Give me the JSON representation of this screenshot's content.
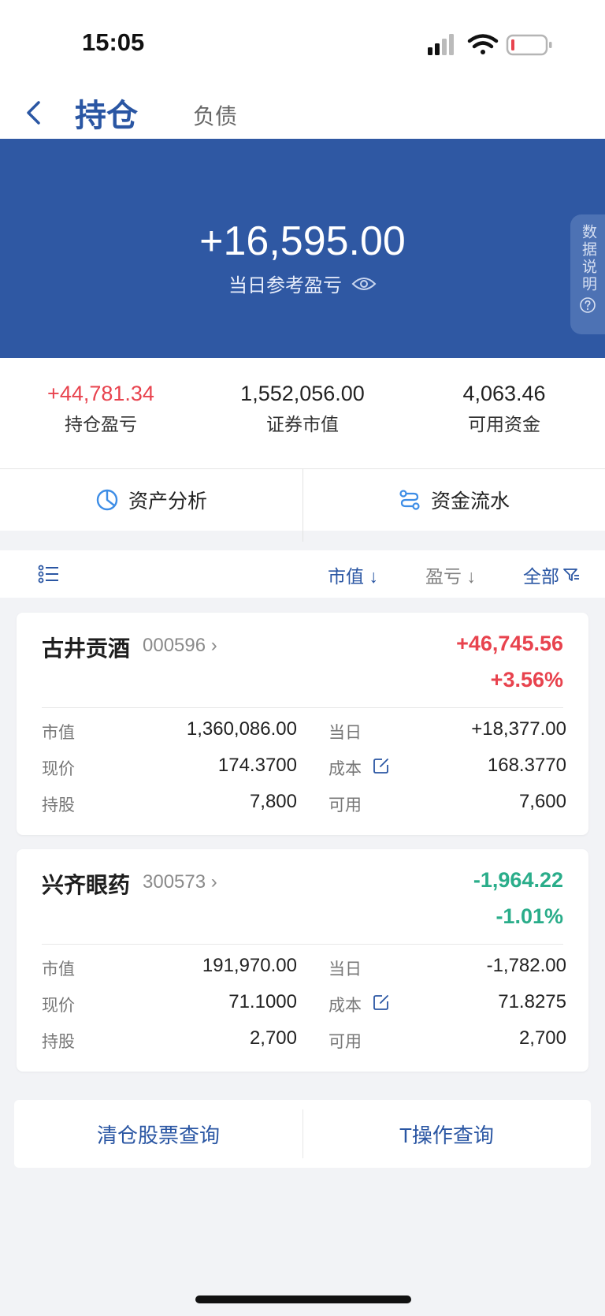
{
  "status": {
    "time": "15:05"
  },
  "nav": {
    "tab_active": "持仓",
    "tab_inactive": "负债"
  },
  "banner": {
    "amount": "+16,595.00",
    "label": "当日参考盈亏",
    "note": "数据说明"
  },
  "summary": [
    {
      "value": "+44,781.34",
      "label": "持仓盈亏"
    },
    {
      "value": "1,552,056.00",
      "label": "证券市值"
    },
    {
      "value": "4,063.46",
      "label": "可用资金"
    }
  ],
  "actions": {
    "analysis": "资产分析",
    "flow": "资金流水"
  },
  "sort": {
    "market_value": "市值 ↓",
    "pnl": "盈亏 ↓",
    "all": "全部"
  },
  "holdings": [
    {
      "name": "古井贡酒",
      "code": "000596 ›",
      "pnl": "+46,745.56",
      "pnl_pct": "+3.56%",
      "market_value_label": "市值",
      "market_value": "1,360,086.00",
      "today_label": "当日",
      "today": "+18,377.00",
      "price_label": "现价",
      "price": "174.3700",
      "cost_label": "成本",
      "cost": "168.3770",
      "shares_label": "持股",
      "shares": "7,800",
      "available_label": "可用",
      "available": "7,600"
    },
    {
      "name": "兴齐眼药",
      "code": "300573 ›",
      "pnl": "-1,964.22",
      "pnl_pct": "-1.01%",
      "market_value_label": "市值",
      "market_value": "191,970.00",
      "today_label": "当日",
      "today": "-1,782.00",
      "price_label": "现价",
      "price": "71.1000",
      "cost_label": "成本",
      "cost": "71.8275",
      "shares_label": "持股",
      "shares": "2,700",
      "available_label": "可用",
      "available": "2,700"
    }
  ],
  "bottom": {
    "cleared_query": "清仓股票查询",
    "t_query": "T操作查询"
  },
  "colors": {
    "brand": "#2f58a3",
    "up": "#e8434e",
    "down": "#2aad8a"
  }
}
